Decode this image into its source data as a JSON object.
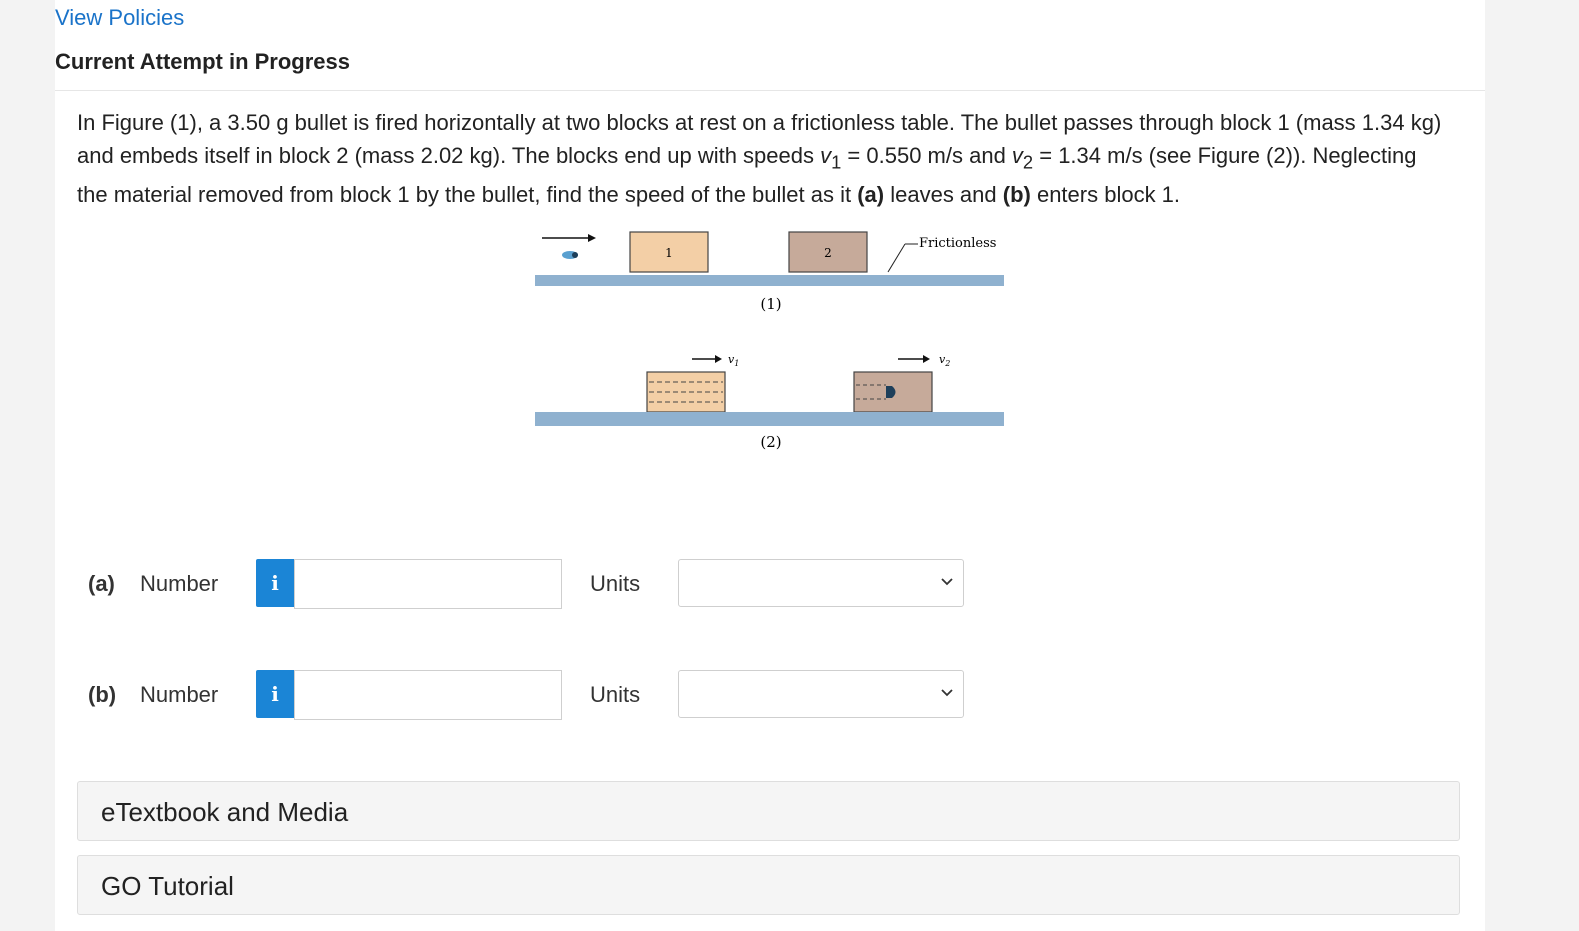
{
  "header": {
    "view_policies": "View Policies",
    "attempt_status": "Current Attempt in Progress"
  },
  "question": {
    "text_1": "In Figure (1), a 3.50 g bullet is fired horizontally at two blocks at rest on a frictionless table. The bullet passes through block 1 (mass 1.34 kg) and embeds itself in block 2 (mass 2.02 kg). The blocks end up with speeds ",
    "v1_symbol": "v",
    "v1_sub": "1",
    "text_2": " = 0.550 m/s and ",
    "v2_symbol": "v",
    "v2_sub": "2",
    "text_3": " = 1.34 m/s (see Figure (2)). Neglecting the material removed from block 1 by the bullet, find the speed of the bullet as it ",
    "part_a_bold": "(a)",
    "text_4": " leaves and ",
    "part_b_bold": "(b)",
    "text_5": " enters block 1."
  },
  "figure": {
    "block1_label": "1",
    "block2_label": "2",
    "frictionless_label": "Frictionless",
    "fig1_caption": "(1)",
    "fig2_caption": "(2)",
    "v1_label": "v",
    "v1_sub": "1",
    "v2_label": "v",
    "v2_sub": "2",
    "colors": {
      "table": "#8fb1cf",
      "block1": "#f3cfa6",
      "block2": "#c6aa9a",
      "bullet": "#5aa0d0"
    }
  },
  "answers": [
    {
      "part": "(a)",
      "number_label": "Number",
      "info_icon": "i",
      "value": "",
      "units_label": "Units",
      "units_selected": ""
    },
    {
      "part": "(b)",
      "number_label": "Number",
      "info_icon": "i",
      "value": "",
      "units_label": "Units",
      "units_selected": ""
    }
  ],
  "accordions": {
    "etextbook": "eTextbook and Media",
    "go_tutorial": "GO Tutorial"
  }
}
